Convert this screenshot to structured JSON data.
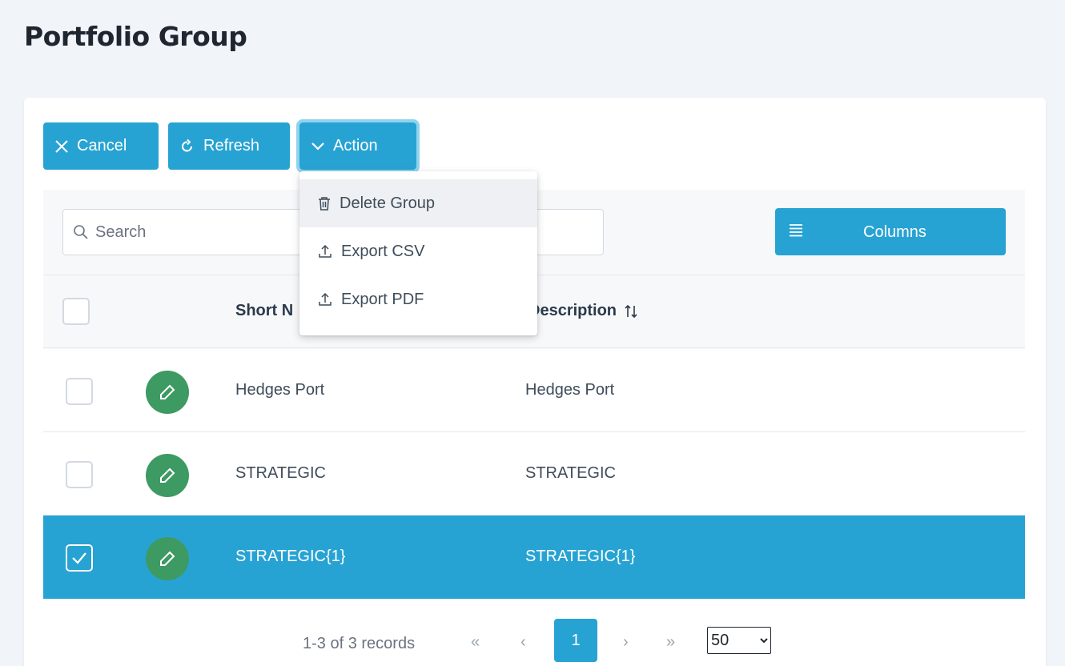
{
  "page": {
    "title": "Portfolio Group"
  },
  "toolbar": {
    "cancel_label": "Cancel",
    "refresh_label": "Refresh",
    "action_label": "Action"
  },
  "action_menu": {
    "items": [
      {
        "label": "Delete Group",
        "icon": "trash-icon"
      },
      {
        "label": "Export CSV",
        "icon": "upload-icon"
      },
      {
        "label": "Export PDF",
        "icon": "upload-icon"
      }
    ]
  },
  "search": {
    "placeholder": "Search"
  },
  "columns_button": {
    "label": "Columns"
  },
  "table": {
    "headers": {
      "short_name": "Short N",
      "description": "Description"
    },
    "rows": [
      {
        "short_name": "Hedges Port",
        "description": "Hedges Port",
        "selected": false
      },
      {
        "short_name": "STRATEGIC",
        "description": "STRATEGIC",
        "selected": false
      },
      {
        "short_name": "STRATEGIC{1}",
        "description": "STRATEGIC{1}",
        "selected": true
      }
    ]
  },
  "pagination": {
    "summary": "1-3 of 3 records",
    "first": "«",
    "prev": "‹",
    "current_page": "1",
    "next": "›",
    "last": "»",
    "page_size": "50"
  },
  "colors": {
    "primary": "#27a3d3",
    "edit_button": "#3d9a62",
    "page_background": "#f1f4f8"
  }
}
